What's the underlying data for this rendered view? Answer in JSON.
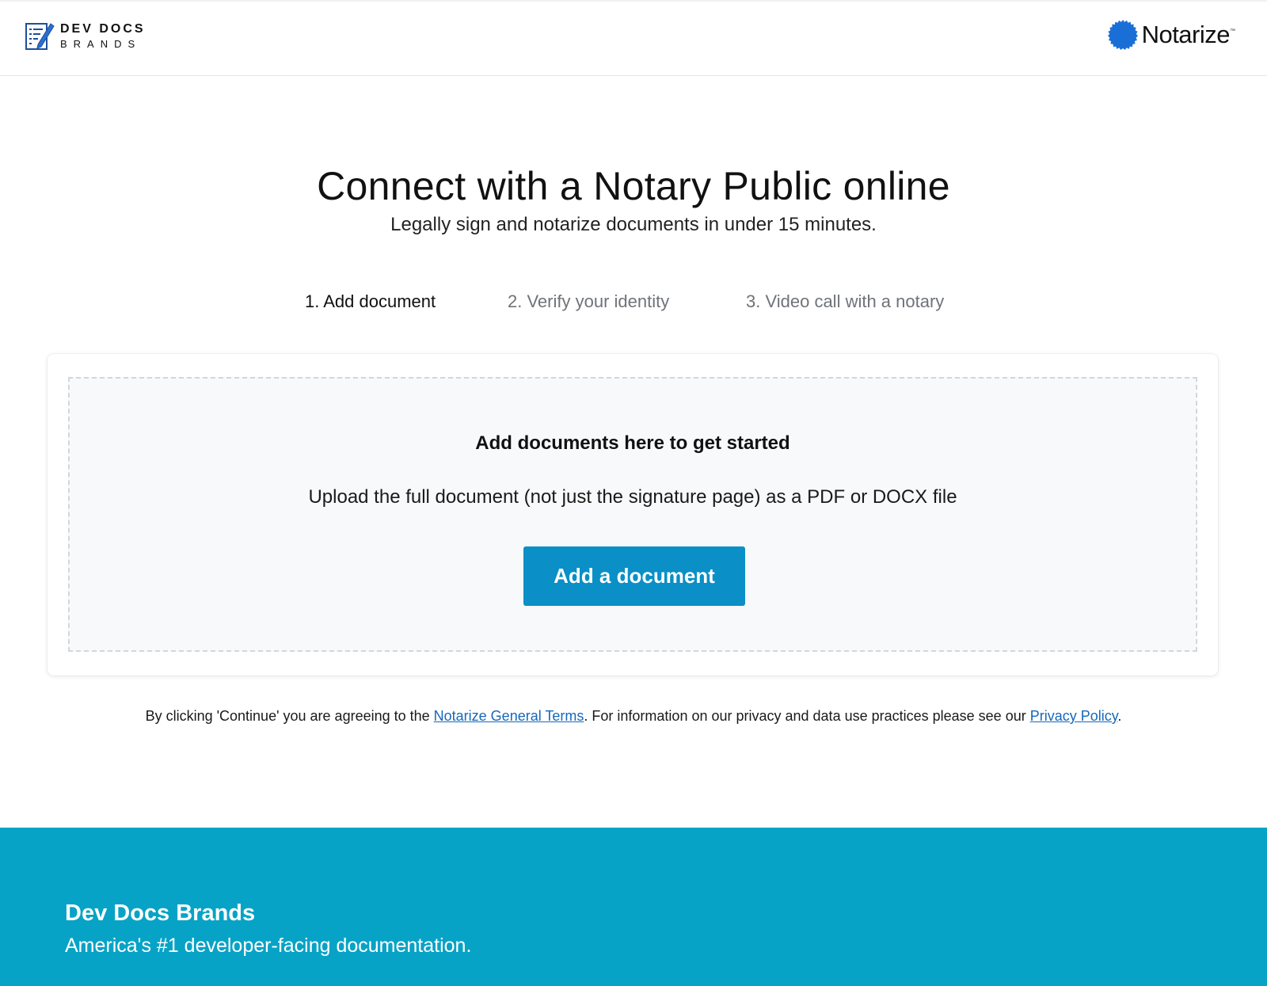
{
  "header": {
    "brand_line1": "DEV DOCS",
    "brand_line2": "BRANDS",
    "partner_name": "Notarize",
    "partner_tm": "™",
    "partner_color": "#1a6fd6"
  },
  "hero": {
    "title": "Connect with a Notary Public online",
    "subtitle": "Legally sign and notarize documents in under 15 minutes."
  },
  "steps": [
    {
      "label": "1. Add document",
      "state": "active"
    },
    {
      "label": "2. Verify your identity",
      "state": "inactive"
    },
    {
      "label": "3. Video call with a notary",
      "state": "inactive"
    }
  ],
  "upload": {
    "title": "Add documents here to get started",
    "description": "Upload the full document (not just the signature page) as a PDF or DOCX file",
    "button_label": "Add a document",
    "button_color": "#0a8fc6"
  },
  "legal": {
    "prefix": "By clicking 'Continue' you are agreeing to the ",
    "terms_link": "Notarize General Terms",
    "middle": ". For information on our privacy and data use practices please see our ",
    "privacy_link": "Privacy Policy",
    "suffix": "."
  },
  "footer": {
    "title": "Dev Docs Brands",
    "tagline": "America's #1 developer-facing documentation.",
    "background": "#07a3c6"
  }
}
